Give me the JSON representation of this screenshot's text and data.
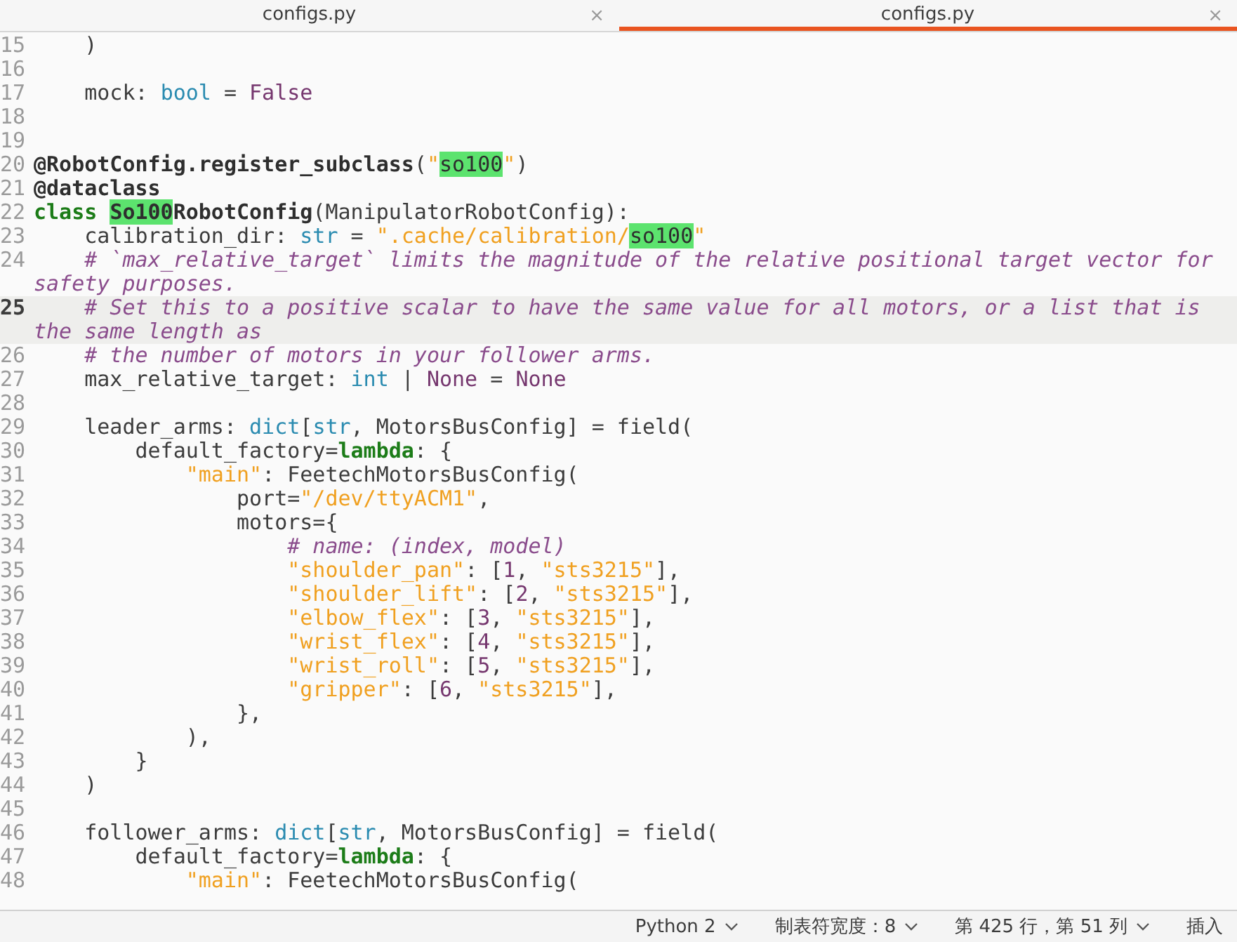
{
  "tabs": [
    {
      "label": "configs.py",
      "selected": false,
      "close": "×"
    },
    {
      "label": "configs.py",
      "selected": true,
      "close": "×"
    }
  ],
  "lines": [
    {
      "number": "15",
      "current": false,
      "tokens": [
        {
          "text": "    )",
          "kind": "plain"
        }
      ]
    },
    {
      "number": "16",
      "current": false
    },
    {
      "number": "17",
      "current": false,
      "tokens": [
        {
          "text": "    mock: ",
          "kind": "plain"
        },
        {
          "text": "bool",
          "kind": "type"
        },
        {
          "text": " = ",
          "kind": "plain"
        },
        {
          "text": "False",
          "kind": "const"
        }
      ]
    },
    {
      "number": "18",
      "current": false
    },
    {
      "number": "19",
      "current": false
    },
    {
      "number": "20",
      "current": false,
      "tokens": [
        {
          "text": "@RobotConfig.register_subclass",
          "kind": "decorator"
        },
        {
          "text": "(",
          "kind": "plain"
        },
        {
          "text": "\"",
          "kind": "string"
        },
        {
          "text": "so100",
          "kind": "match"
        },
        {
          "text": "\"",
          "kind": "string"
        },
        {
          "text": ")",
          "kind": "plain"
        }
      ]
    },
    {
      "number": "21",
      "current": false,
      "tokens": [
        {
          "text": "@dataclass",
          "kind": "decorator"
        }
      ]
    },
    {
      "number": "22",
      "current": false,
      "tokens": [
        {
          "text": "class ",
          "kind": "keyword"
        },
        {
          "text": "So100",
          "kind": "matchbold"
        },
        {
          "text": "RobotConfig",
          "kind": "decorator"
        },
        {
          "text": "(ManipulatorRobotConfig):",
          "kind": "plain"
        }
      ]
    },
    {
      "number": "23",
      "current": false,
      "tokens": [
        {
          "text": "    calibration_dir: ",
          "kind": "plain"
        },
        {
          "text": "str",
          "kind": "type"
        },
        {
          "text": " = ",
          "kind": "plain"
        },
        {
          "text": "\".cache/calibration/",
          "kind": "string"
        },
        {
          "text": "so100",
          "kind": "match"
        },
        {
          "text": "\"",
          "kind": "string"
        }
      ]
    },
    {
      "number": "24",
      "current": false,
      "tokens": [
        {
          "text": "    # `max_relative_target` limits the magnitude of the relative positional target vector for safety purposes.",
          "kind": "comment"
        }
      ]
    },
    {
      "number": "25",
      "current": true,
      "tokens": [
        {
          "text": "    # Set this to a positive scalar to have the same value for all motors, or a list that is the same length as",
          "kind": "comment"
        }
      ]
    },
    {
      "number": "26",
      "current": false,
      "tokens": [
        {
          "text": "    # the number of motors in your follower arms.",
          "kind": "comment"
        }
      ]
    },
    {
      "number": "27",
      "current": false,
      "tokens": [
        {
          "text": "    max_relative_target: ",
          "kind": "plain"
        },
        {
          "text": "int",
          "kind": "type"
        },
        {
          "text": " | ",
          "kind": "plain"
        },
        {
          "text": "None",
          "kind": "const"
        },
        {
          "text": " = ",
          "kind": "plain"
        },
        {
          "text": "None",
          "kind": "const"
        }
      ]
    },
    {
      "number": "28",
      "current": false
    },
    {
      "number": "29",
      "current": false,
      "tokens": [
        {
          "text": "    leader_arms: ",
          "kind": "plain"
        },
        {
          "text": "dict",
          "kind": "type"
        },
        {
          "text": "[",
          "kind": "plain"
        },
        {
          "text": "str",
          "kind": "type"
        },
        {
          "text": ", MotorsBusConfig] = field(",
          "kind": "plain"
        }
      ]
    },
    {
      "number": "30",
      "current": false,
      "tokens": [
        {
          "text": "        default_factory=",
          "kind": "plain"
        },
        {
          "text": "lambda",
          "kind": "keyword"
        },
        {
          "text": ": {",
          "kind": "plain"
        }
      ]
    },
    {
      "number": "31",
      "current": false,
      "tokens": [
        {
          "text": "            \"main\"",
          "kind": "string"
        },
        {
          "text": ": FeetechMotorsBusConfig(",
          "kind": "plain"
        }
      ]
    },
    {
      "number": "32",
      "current": false,
      "tokens": [
        {
          "text": "                port=",
          "kind": "plain"
        },
        {
          "text": "\"/dev/ttyACM1\"",
          "kind": "string"
        },
        {
          "text": ",",
          "kind": "plain"
        }
      ]
    },
    {
      "number": "33",
      "current": false,
      "tokens": [
        {
          "text": "                motors={",
          "kind": "plain"
        }
      ]
    },
    {
      "number": "34",
      "current": false,
      "tokens": [
        {
          "text": "                    # name: (index, model)",
          "kind": "comment"
        }
      ]
    },
    {
      "number": "35",
      "current": false,
      "tokens": [
        {
          "text": "                    \"shoulder_pan\"",
          "kind": "string"
        },
        {
          "text": ": [",
          "kind": "plain"
        },
        {
          "text": "1",
          "kind": "const"
        },
        {
          "text": ", ",
          "kind": "plain"
        },
        {
          "text": "\"sts3215\"",
          "kind": "string"
        },
        {
          "text": "],",
          "kind": "plain"
        }
      ]
    },
    {
      "number": "36",
      "current": false,
      "tokens": [
        {
          "text": "                    \"shoulder_lift\"",
          "kind": "string"
        },
        {
          "text": ": [",
          "kind": "plain"
        },
        {
          "text": "2",
          "kind": "const"
        },
        {
          "text": ", ",
          "kind": "plain"
        },
        {
          "text": "\"sts3215\"",
          "kind": "string"
        },
        {
          "text": "],",
          "kind": "plain"
        }
      ]
    },
    {
      "number": "37",
      "current": false,
      "tokens": [
        {
          "text": "                    \"elbow_flex\"",
          "kind": "string"
        },
        {
          "text": ": [",
          "kind": "plain"
        },
        {
          "text": "3",
          "kind": "const"
        },
        {
          "text": ", ",
          "kind": "plain"
        },
        {
          "text": "\"sts3215\"",
          "kind": "string"
        },
        {
          "text": "],",
          "kind": "plain"
        }
      ]
    },
    {
      "number": "38",
      "current": false,
      "tokens": [
        {
          "text": "                    \"wrist_flex\"",
          "kind": "string"
        },
        {
          "text": ": [",
          "kind": "plain"
        },
        {
          "text": "4",
          "kind": "const"
        },
        {
          "text": ", ",
          "kind": "plain"
        },
        {
          "text": "\"sts3215\"",
          "kind": "string"
        },
        {
          "text": "],",
          "kind": "plain"
        }
      ]
    },
    {
      "number": "39",
      "current": false,
      "tokens": [
        {
          "text": "                    \"wrist_roll\"",
          "kind": "string"
        },
        {
          "text": ": [",
          "kind": "plain"
        },
        {
          "text": "5",
          "kind": "const"
        },
        {
          "text": ", ",
          "kind": "plain"
        },
        {
          "text": "\"sts3215\"",
          "kind": "string"
        },
        {
          "text": "],",
          "kind": "plain"
        }
      ]
    },
    {
      "number": "40",
      "current": false,
      "tokens": [
        {
          "text": "                    \"gripper\"",
          "kind": "string"
        },
        {
          "text": ": [",
          "kind": "plain"
        },
        {
          "text": "6",
          "kind": "const"
        },
        {
          "text": ", ",
          "kind": "plain"
        },
        {
          "text": "\"sts3215\"",
          "kind": "string"
        },
        {
          "text": "],",
          "kind": "plain"
        }
      ]
    },
    {
      "number": "41",
      "current": false,
      "tokens": [
        {
          "text": "                },",
          "kind": "plain"
        }
      ]
    },
    {
      "number": "42",
      "current": false,
      "tokens": [
        {
          "text": "            ),",
          "kind": "plain"
        }
      ]
    },
    {
      "number": "43",
      "current": false,
      "tokens": [
        {
          "text": "        }",
          "kind": "plain"
        }
      ]
    },
    {
      "number": "44",
      "current": false,
      "tokens": [
        {
          "text": "    )",
          "kind": "plain"
        }
      ]
    },
    {
      "number": "45",
      "current": false
    },
    {
      "number": "46",
      "current": false,
      "tokens": [
        {
          "text": "    follower_arms: ",
          "kind": "plain"
        },
        {
          "text": "dict",
          "kind": "type"
        },
        {
          "text": "[",
          "kind": "plain"
        },
        {
          "text": "str",
          "kind": "type"
        },
        {
          "text": ", MotorsBusConfig] = field(",
          "kind": "plain"
        }
      ]
    },
    {
      "number": "47",
      "current": false,
      "tokens": [
        {
          "text": "        default_factory=",
          "kind": "plain"
        },
        {
          "text": "lambda",
          "kind": "keyword"
        },
        {
          "text": ": {",
          "kind": "plain"
        }
      ]
    },
    {
      "number": "48",
      "current": false,
      "tokens": [
        {
          "text": "            \"main\"",
          "kind": "string"
        },
        {
          "text": ": FeetechMotorsBusConfig(",
          "kind": "plain"
        }
      ]
    }
  ],
  "status_bar": [
    {
      "label": "Python 2",
      "dropdown": true
    },
    {
      "label": "制表符宽度：8",
      "dropdown": true
    },
    {
      "label": "第 425 行，第 51 列",
      "dropdown": true
    },
    {
      "label": "插入",
      "dropdown": false
    }
  ]
}
